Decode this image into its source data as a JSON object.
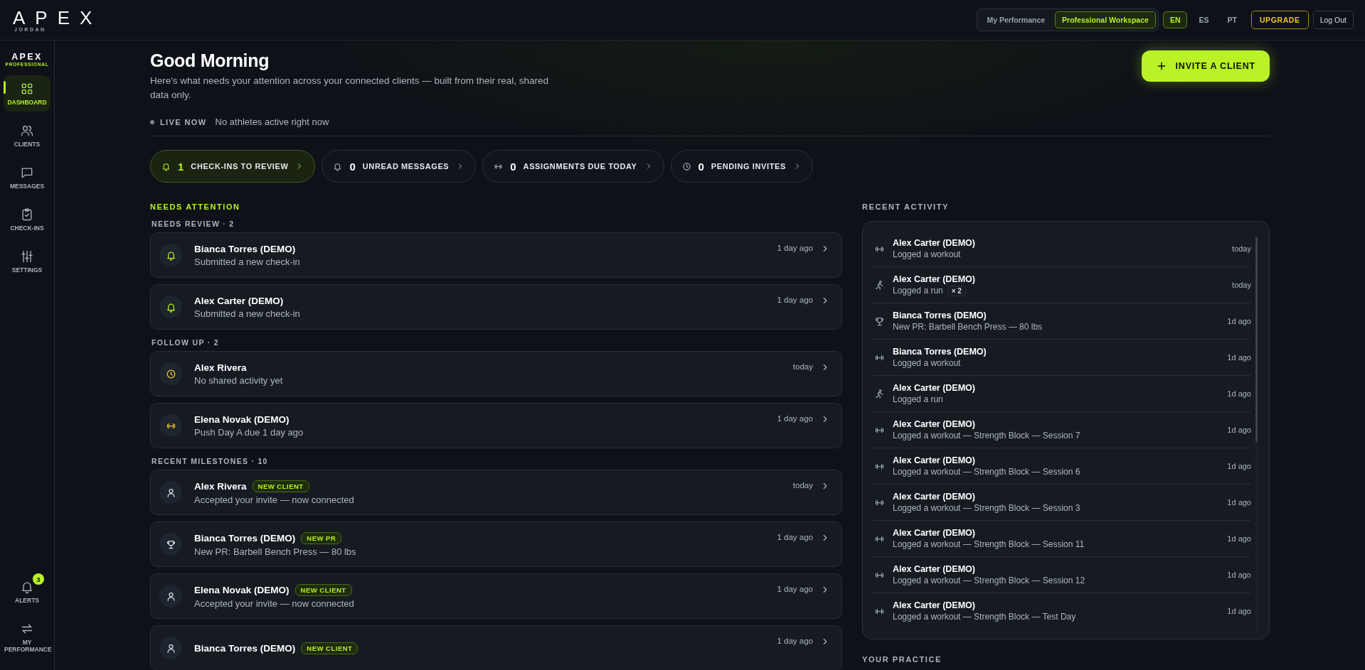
{
  "topbar": {
    "logo": "APEX",
    "logo_sub": "JORDAN",
    "workspace_tabs": [
      {
        "label": "My Performance",
        "selected": false
      },
      {
        "label": "Professional Workspace",
        "selected": true
      }
    ],
    "languages": [
      {
        "label": "EN",
        "selected": true
      },
      {
        "label": "ES",
        "selected": false
      },
      {
        "label": "PT",
        "selected": false
      }
    ],
    "upgrade": "UPGRADE",
    "logout": "Log Out"
  },
  "sidebar": {
    "brand": "APEX",
    "brand_sub": "PROFESSIONAL",
    "items": [
      {
        "label": "DASHBOARD",
        "kind": "grid",
        "selected": true
      },
      {
        "label": "CLIENTS",
        "kind": "users",
        "selected": false
      },
      {
        "label": "MESSAGES",
        "kind": "message",
        "selected": false
      },
      {
        "label": "CHECK-INS",
        "kind": "clipboard",
        "selected": false
      },
      {
        "label": "SETTINGS",
        "kind": "sliders",
        "selected": false
      }
    ],
    "bottom_items": [
      {
        "label": "ALERTS",
        "kind": "bell",
        "badge": "3",
        "selected": false
      },
      {
        "label": "MY PERFORMANCE",
        "kind": "swap",
        "selected": false
      }
    ]
  },
  "header": {
    "greeting": "Good Morning",
    "subtitle": "Here's what needs your attention across your connected clients — built from their real, shared data only.",
    "invite_button": "INVITE A CLIENT"
  },
  "live": {
    "label": "LIVE NOW",
    "status": "No athletes active right now"
  },
  "stats": [
    {
      "kind": "bell",
      "count": "1",
      "label": "CHECK-INS TO REVIEW",
      "selected": true
    },
    {
      "kind": "bell",
      "count": "0",
      "label": "UNREAD MESSAGES",
      "selected": false
    },
    {
      "kind": "dumbbell",
      "count": "0",
      "label": "ASSIGNMENTS DUE TODAY",
      "selected": false
    },
    {
      "kind": "clock",
      "count": "0",
      "label": "PENDING INVITES",
      "selected": false
    }
  ],
  "needs_attention": {
    "title": "NEEDS ATTENTION",
    "sections": [
      {
        "heading": "NEEDS REVIEW · 2",
        "kind": "review",
        "items": [
          {
            "kind": "bell",
            "name": "Bianca Torres (DEMO)",
            "detail": "Submitted a new check-in",
            "time": "1 day ago"
          },
          {
            "kind": "bell",
            "name": "Alex Carter (DEMO)",
            "detail": "Submitted a new check-in",
            "time": "1 day ago"
          }
        ]
      },
      {
        "heading": "FOLLOW UP · 2",
        "kind": "followup",
        "items": [
          {
            "kind": "clock",
            "name": "Alex Rivera",
            "detail": "No shared activity yet",
            "time": "today"
          },
          {
            "kind": "dumbbell",
            "name": "Elena Novak (DEMO)",
            "detail": "Push Day A due 1 day ago",
            "time": "1 day ago"
          }
        ]
      },
      {
        "heading": "RECENT MILESTONES · 10",
        "kind": "milestone",
        "items": [
          {
            "kind": "person",
            "name": "Alex Rivera",
            "badge": "NEW CLIENT",
            "detail": "Accepted your invite — now connected",
            "time": "today"
          },
          {
            "kind": "trophy",
            "name": "Bianca Torres (DEMO)",
            "badge": "NEW PR",
            "detail": "New PR: Barbell Bench Press — 80 lbs",
            "time": "1 day ago"
          },
          {
            "kind": "person",
            "name": "Elena Novak (DEMO)",
            "badge": "NEW CLIENT",
            "detail": "Accepted your invite — now connected",
            "time": "1 day ago"
          },
          {
            "kind": "person",
            "name": "Bianca Torres (DEMO)",
            "badge": "NEW CLIENT",
            "time": "1 day ago"
          }
        ]
      }
    ]
  },
  "recent_activity": {
    "title": "RECENT ACTIVITY",
    "items": [
      {
        "kind": "dumbbell",
        "name": "Alex Carter (DEMO)",
        "detail": "Logged a workout",
        "time": "today"
      },
      {
        "kind": "runner",
        "name": "Alex Carter (DEMO)",
        "detail": "Logged a run",
        "count": "× 2",
        "time": "today"
      },
      {
        "kind": "trophy",
        "name": "Bianca Torres (DEMO)",
        "detail": "New PR: Barbell Bench Press — 80 lbs",
        "time": "1d ago"
      },
      {
        "kind": "dumbbell",
        "name": "Bianca Torres (DEMO)",
        "detail": "Logged a workout",
        "time": "1d ago"
      },
      {
        "kind": "runner",
        "name": "Alex Carter (DEMO)",
        "detail": "Logged a run",
        "time": "1d ago"
      },
      {
        "kind": "dumbbell",
        "name": "Alex Carter (DEMO)",
        "detail": "Logged a workout — Strength Block — Session 7",
        "time": "1d ago"
      },
      {
        "kind": "dumbbell",
        "name": "Alex Carter (DEMO)",
        "detail": "Logged a workout — Strength Block — Session 6",
        "time": "1d ago"
      },
      {
        "kind": "dumbbell",
        "name": "Alex Carter (DEMO)",
        "detail": "Logged a workout — Strength Block — Session 3",
        "time": "1d ago"
      },
      {
        "kind": "dumbbell",
        "name": "Alex Carter (DEMO)",
        "detail": "Logged a workout — Strength Block — Session 11",
        "time": "1d ago"
      },
      {
        "kind": "dumbbell",
        "name": "Alex Carter (DEMO)",
        "detail": "Logged a workout — Strength Block — Session 12",
        "time": "1d ago"
      },
      {
        "kind": "dumbbell",
        "name": "Alex Carter (DEMO)",
        "detail": "Logged a workout — Strength Block — Test Day",
        "time": "1d ago"
      }
    ]
  },
  "your_practice": {
    "title": "YOUR PRACTICE"
  }
}
